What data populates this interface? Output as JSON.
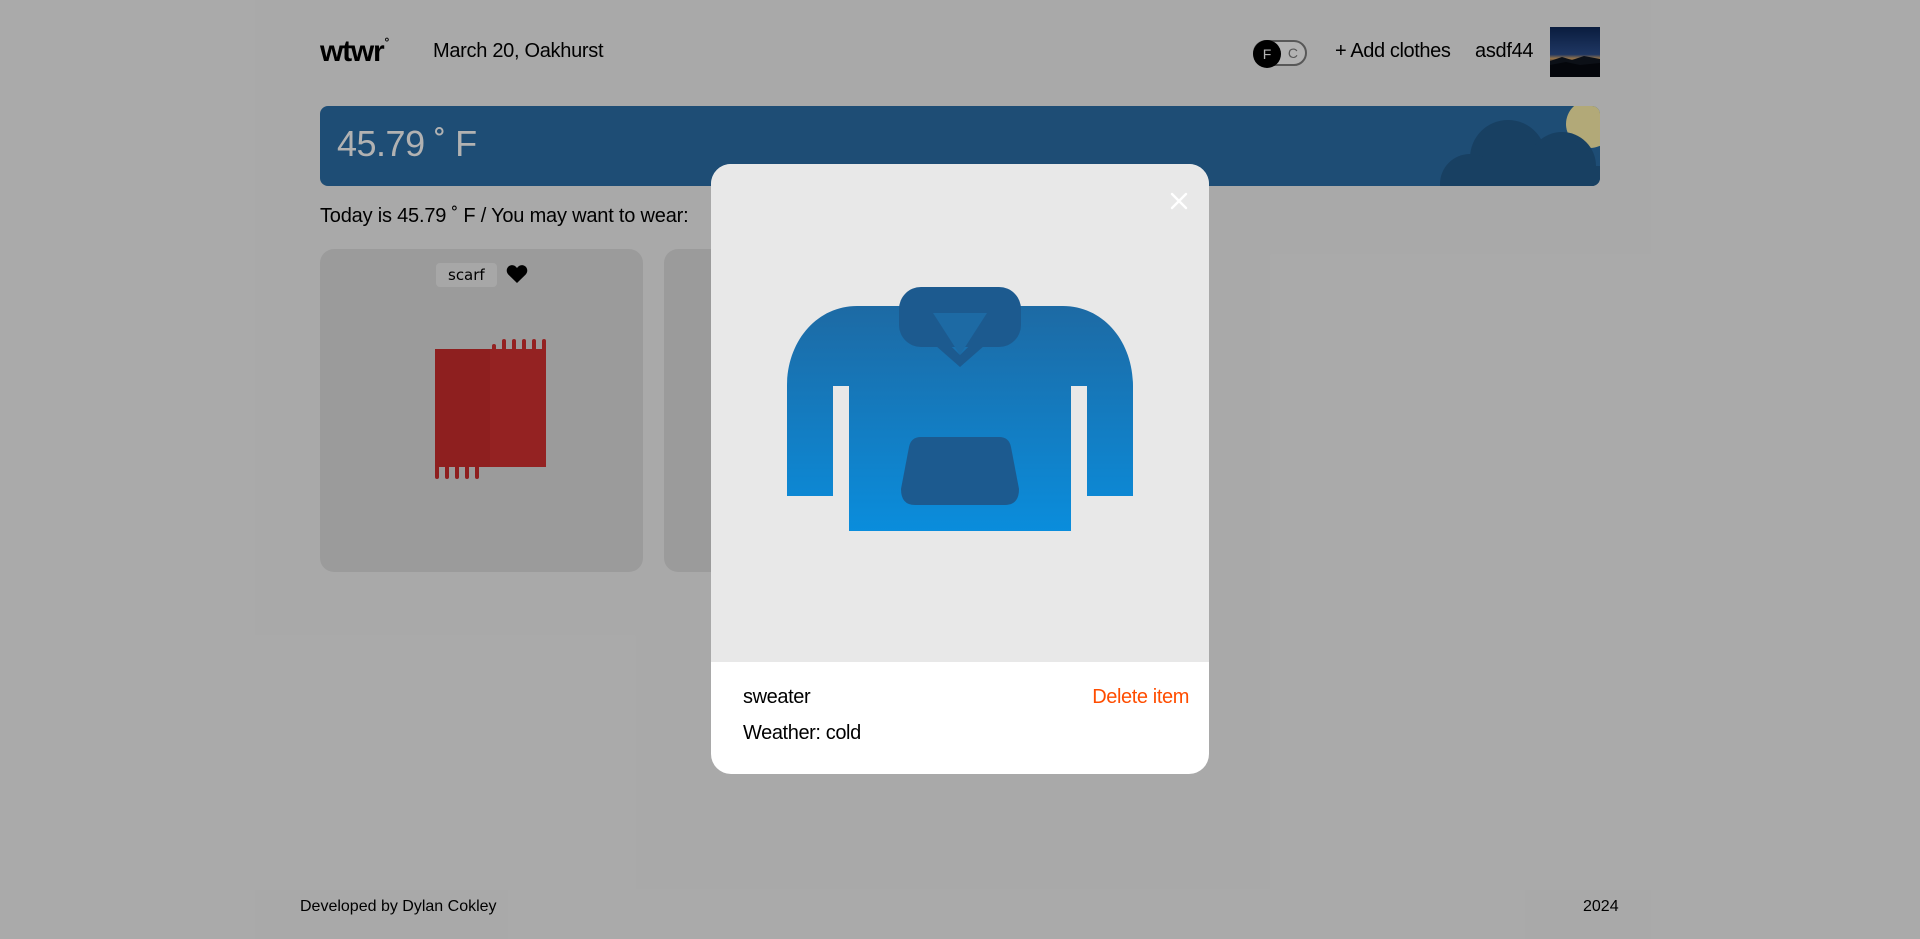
{
  "header": {
    "logo": "wtwr",
    "logo_degree": "°",
    "date_location": "March 20, Oakhurst",
    "temp_toggle": {
      "f_label": "F",
      "c_label": "C",
      "selected": "F"
    },
    "add_clothes_label": "+ Add clothes",
    "username": "asdf44"
  },
  "weather": {
    "temperature": "45.79 ˚ F",
    "condition_icons": [
      "cloud-icon",
      "sun-icon"
    ]
  },
  "main": {
    "today_text": "Today is 45.79 ˚ F / You may want to wear:",
    "cards": [
      {
        "name": "scarf",
        "icon": "scarf-icon",
        "liked": true
      }
    ]
  },
  "modal": {
    "item_name": "sweater",
    "item_icon": "sweater-icon",
    "delete_label": "Delete item",
    "weather_label": "Weather: cold"
  },
  "footer": {
    "credit": "Developed by Dylan Cokley",
    "year": "2024"
  },
  "colors": {
    "weather_card": "#2b6fa8",
    "delete_accent": "#ff4d00",
    "sweater_top": "#1d6aa4",
    "sweater_bottom": "#0a8ddc",
    "scarf": "#cc2d2d"
  }
}
